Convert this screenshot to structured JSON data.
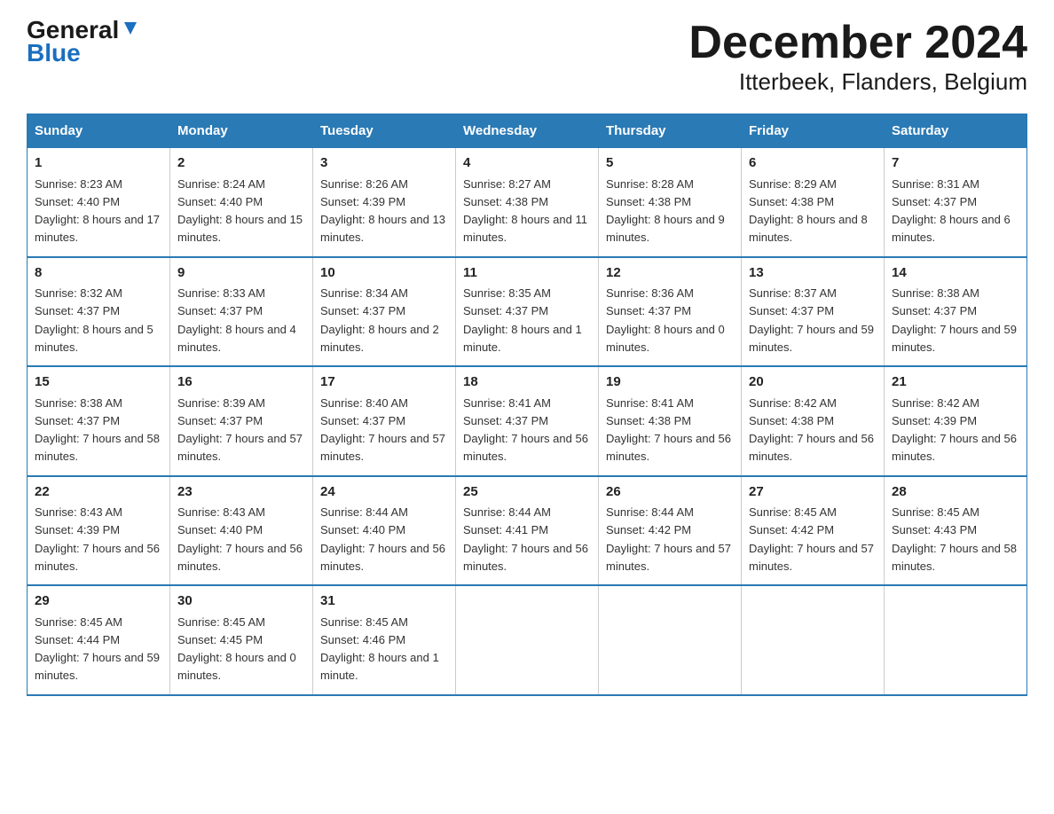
{
  "header": {
    "logo_line1": "General",
    "logo_line2": "Blue",
    "title": "December 2024",
    "subtitle": "Itterbeek, Flanders, Belgium"
  },
  "columns": [
    "Sunday",
    "Monday",
    "Tuesday",
    "Wednesday",
    "Thursday",
    "Friday",
    "Saturday"
  ],
  "weeks": [
    [
      {
        "num": "1",
        "sunrise": "8:23 AM",
        "sunset": "4:40 PM",
        "daylight": "8 hours and 17 minutes."
      },
      {
        "num": "2",
        "sunrise": "8:24 AM",
        "sunset": "4:40 PM",
        "daylight": "8 hours and 15 minutes."
      },
      {
        "num": "3",
        "sunrise": "8:26 AM",
        "sunset": "4:39 PM",
        "daylight": "8 hours and 13 minutes."
      },
      {
        "num": "4",
        "sunrise": "8:27 AM",
        "sunset": "4:38 PM",
        "daylight": "8 hours and 11 minutes."
      },
      {
        "num": "5",
        "sunrise": "8:28 AM",
        "sunset": "4:38 PM",
        "daylight": "8 hours and 9 minutes."
      },
      {
        "num": "6",
        "sunrise": "8:29 AM",
        "sunset": "4:38 PM",
        "daylight": "8 hours and 8 minutes."
      },
      {
        "num": "7",
        "sunrise": "8:31 AM",
        "sunset": "4:37 PM",
        "daylight": "8 hours and 6 minutes."
      }
    ],
    [
      {
        "num": "8",
        "sunrise": "8:32 AM",
        "sunset": "4:37 PM",
        "daylight": "8 hours and 5 minutes."
      },
      {
        "num": "9",
        "sunrise": "8:33 AM",
        "sunset": "4:37 PM",
        "daylight": "8 hours and 4 minutes."
      },
      {
        "num": "10",
        "sunrise": "8:34 AM",
        "sunset": "4:37 PM",
        "daylight": "8 hours and 2 minutes."
      },
      {
        "num": "11",
        "sunrise": "8:35 AM",
        "sunset": "4:37 PM",
        "daylight": "8 hours and 1 minute."
      },
      {
        "num": "12",
        "sunrise": "8:36 AM",
        "sunset": "4:37 PM",
        "daylight": "8 hours and 0 minutes."
      },
      {
        "num": "13",
        "sunrise": "8:37 AM",
        "sunset": "4:37 PM",
        "daylight": "7 hours and 59 minutes."
      },
      {
        "num": "14",
        "sunrise": "8:38 AM",
        "sunset": "4:37 PM",
        "daylight": "7 hours and 59 minutes."
      }
    ],
    [
      {
        "num": "15",
        "sunrise": "8:38 AM",
        "sunset": "4:37 PM",
        "daylight": "7 hours and 58 minutes."
      },
      {
        "num": "16",
        "sunrise": "8:39 AM",
        "sunset": "4:37 PM",
        "daylight": "7 hours and 57 minutes."
      },
      {
        "num": "17",
        "sunrise": "8:40 AM",
        "sunset": "4:37 PM",
        "daylight": "7 hours and 57 minutes."
      },
      {
        "num": "18",
        "sunrise": "8:41 AM",
        "sunset": "4:37 PM",
        "daylight": "7 hours and 56 minutes."
      },
      {
        "num": "19",
        "sunrise": "8:41 AM",
        "sunset": "4:38 PM",
        "daylight": "7 hours and 56 minutes."
      },
      {
        "num": "20",
        "sunrise": "8:42 AM",
        "sunset": "4:38 PM",
        "daylight": "7 hours and 56 minutes."
      },
      {
        "num": "21",
        "sunrise": "8:42 AM",
        "sunset": "4:39 PM",
        "daylight": "7 hours and 56 minutes."
      }
    ],
    [
      {
        "num": "22",
        "sunrise": "8:43 AM",
        "sunset": "4:39 PM",
        "daylight": "7 hours and 56 minutes."
      },
      {
        "num": "23",
        "sunrise": "8:43 AM",
        "sunset": "4:40 PM",
        "daylight": "7 hours and 56 minutes."
      },
      {
        "num": "24",
        "sunrise": "8:44 AM",
        "sunset": "4:40 PM",
        "daylight": "7 hours and 56 minutes."
      },
      {
        "num": "25",
        "sunrise": "8:44 AM",
        "sunset": "4:41 PM",
        "daylight": "7 hours and 56 minutes."
      },
      {
        "num": "26",
        "sunrise": "8:44 AM",
        "sunset": "4:42 PM",
        "daylight": "7 hours and 57 minutes."
      },
      {
        "num": "27",
        "sunrise": "8:45 AM",
        "sunset": "4:42 PM",
        "daylight": "7 hours and 57 minutes."
      },
      {
        "num": "28",
        "sunrise": "8:45 AM",
        "sunset": "4:43 PM",
        "daylight": "7 hours and 58 minutes."
      }
    ],
    [
      {
        "num": "29",
        "sunrise": "8:45 AM",
        "sunset": "4:44 PM",
        "daylight": "7 hours and 59 minutes."
      },
      {
        "num": "30",
        "sunrise": "8:45 AM",
        "sunset": "4:45 PM",
        "daylight": "8 hours and 0 minutes."
      },
      {
        "num": "31",
        "sunrise": "8:45 AM",
        "sunset": "4:46 PM",
        "daylight": "8 hours and 1 minute."
      },
      null,
      null,
      null,
      null
    ]
  ]
}
